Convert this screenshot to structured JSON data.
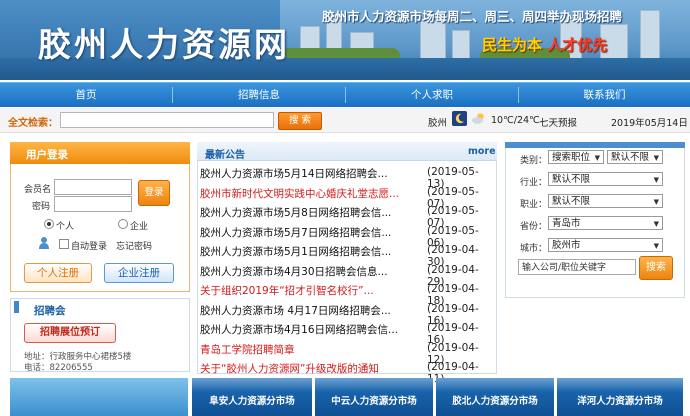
{
  "header": {
    "site_title": "胶州人力资源网",
    "notice": "胶州市人力资源市场每周二、周三、周四举办现场招聘",
    "slogan_part1": "民生为本",
    "slogan_part2": "人才优先"
  },
  "nav": {
    "items": [
      {
        "label": "首页"
      },
      {
        "label": "招聘信息"
      },
      {
        "label": "个人求职"
      },
      {
        "label": "联系我们"
      }
    ]
  },
  "search": {
    "label": "全文检索：",
    "placeholder": "",
    "button": "搜 索"
  },
  "weather": {
    "city": "胶州",
    "moon_icon": "moon-icon",
    "cloud_icon": "cloud-icon",
    "temperature": "10℃/24℃",
    "forecast": "七天预报",
    "date": "2019年05月14日"
  },
  "login": {
    "title": "用户登录",
    "member_label": "会员名",
    "password_label": "密码",
    "login_button": "登录",
    "radio_personal": "个人",
    "radio_company": "企业",
    "auto_login": "自动登录",
    "forgot": "忘记密码",
    "personal_register": "个人注册",
    "company_register": "企业注册"
  },
  "job_fair": {
    "title": "招聘会",
    "booth_button": "招聘展位预订",
    "address": "地址：行政服务中心裙楼5楼",
    "phone": "电话：82206555"
  },
  "news": {
    "title": "最新公告",
    "more": "more",
    "items": [
      {
        "title": "胶州人力资源市场5月14日网络招聘会...",
        "date": "(2019-05-13)",
        "red": false
      },
      {
        "title": "胶州市新时代文明实践中心婚庆礼堂志愿...",
        "date": "(2019-05-07)",
        "red": true
      },
      {
        "title": "胶州人力资源市场5月8日网络招聘会信...",
        "date": "(2019-05-07)",
        "red": false
      },
      {
        "title": "胶州人力资源市场5月7日网络招聘会信...",
        "date": "(2019-05-06)",
        "red": false
      },
      {
        "title": "胶州人力资源市场5月1日网络招聘会信...",
        "date": "(2019-04-30)",
        "red": false
      },
      {
        "title": "胶州人力资源市场4月30日招聘会信息...",
        "date": "(2019-04-29)",
        "red": false
      },
      {
        "title": "关于组织2019年“招才引智名校行”...",
        "date": "(2019-04-18)",
        "red": true
      },
      {
        "title": "胶州人力资源市场 4月17日网络招聘会...",
        "date": "(2019-04-16)",
        "red": false
      },
      {
        "title": "胶州人力资源市场4月16日网络招聘会信...",
        "date": "(2019-04-16)",
        "red": false
      },
      {
        "title": "青岛工学院招聘简章",
        "date": "(2019-04-12)",
        "red": true
      },
      {
        "title": "关于“胶州人力资源网”升级改版的通知",
        "date": "(2019-04-11)",
        "red": true
      }
    ]
  },
  "filter": {
    "category_label": "类别：",
    "category_value": "搜索职位",
    "category_limit": "默认不限",
    "industry_label": "行业：",
    "industry_value": "默认不限",
    "position_label": "职业：",
    "position_value": "默认不限",
    "province_label": "省份：",
    "province_value": "青岛市",
    "city_label": "城市：",
    "city_value": "胶州市",
    "keyword_placeholder": "输入公司/职位关键字",
    "search_button": "搜索"
  },
  "branches": [
    {
      "label": "阜安人力资源分市场"
    },
    {
      "label": "中云人力资源分市场"
    },
    {
      "label": "胶北人力资源分市场"
    },
    {
      "label": "洋河人力资源分市场"
    }
  ]
}
